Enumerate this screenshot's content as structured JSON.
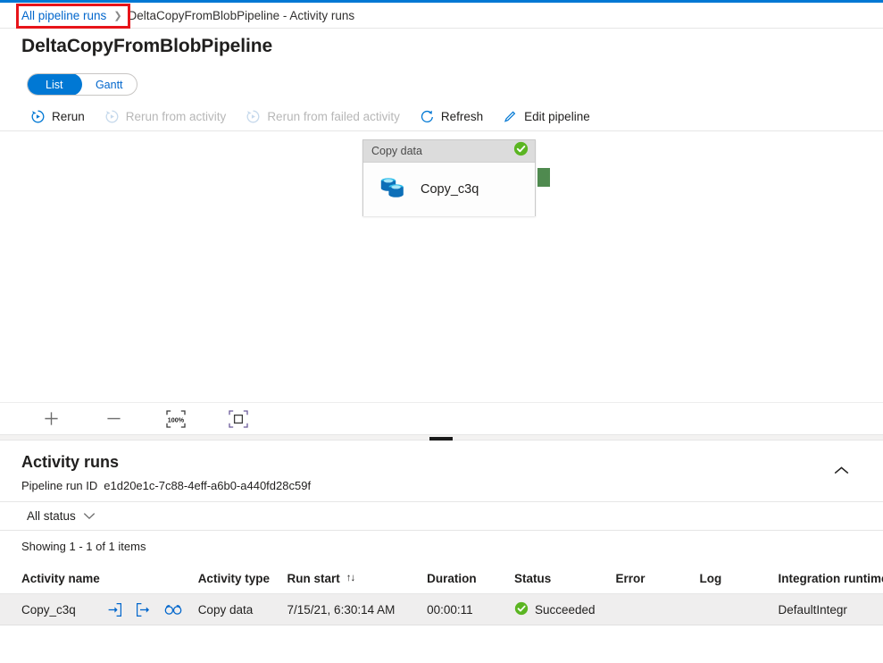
{
  "breadcrumb": {
    "back_link": "All pipeline runs",
    "separator": "❯",
    "current": "DeltaCopyFromBlobPipeline - Activity runs",
    "highlight_color": "#e7141a"
  },
  "page": {
    "title": "DeltaCopyFromBlobPipeline",
    "accent_color": "#0078d4"
  },
  "view_toggle": {
    "options": [
      "List",
      "Gantt"
    ],
    "selected": "List"
  },
  "toolbar": {
    "items": [
      {
        "label": "Rerun",
        "icon": "rerun-icon",
        "disabled": false
      },
      {
        "label": "Rerun from activity",
        "icon": "rerun-from-activity-icon",
        "disabled": true
      },
      {
        "label": "Rerun from failed activity",
        "icon": "rerun-from-failed-activity-icon",
        "disabled": true
      },
      {
        "label": "Refresh",
        "icon": "refresh-icon",
        "disabled": false
      },
      {
        "label": "Edit pipeline",
        "icon": "pencil-icon",
        "disabled": false
      }
    ]
  },
  "canvas": {
    "node": {
      "type_label": "Copy data",
      "name": "Copy_c3q",
      "status": "succeeded",
      "status_color": "#5bb522",
      "icon": "copy-data-icon",
      "connector_color": "#4f8a4f"
    },
    "zoom_controls": [
      {
        "name": "zoom-in",
        "glyph": "+"
      },
      {
        "name": "zoom-out",
        "glyph": "−"
      },
      {
        "name": "zoom-to-100",
        "glyph": "100%"
      },
      {
        "name": "zoom-to-fit",
        "glyph": "fit"
      }
    ]
  },
  "activity_runs": {
    "title": "Activity runs",
    "collapse_icon": "chevron-up-icon",
    "run_id_label": "Pipeline run ID",
    "run_id_value": "e1d20e1c-7c88-4eff-a6b0-a440fd28c59f",
    "status_filter": "All status",
    "showing": "Showing 1 - 1 of 1 items",
    "columns": [
      "Activity name",
      "Activity type",
      "Run start",
      "Duration",
      "Status",
      "Error",
      "Log",
      "Integration runtime"
    ],
    "sort_column": "Run start",
    "rows": [
      {
        "activity_name": "Copy_c3q",
        "row_icons": [
          "input-icon",
          "output-icon",
          "details-icon"
        ],
        "activity_type": "Copy data",
        "run_start": "7/15/21, 6:30:14 AM",
        "duration": "00:00:11",
        "status": "Succeeded",
        "status_color": "#5bb522",
        "error": "",
        "log": "",
        "integration_runtime": "DefaultIntegr"
      }
    ]
  }
}
